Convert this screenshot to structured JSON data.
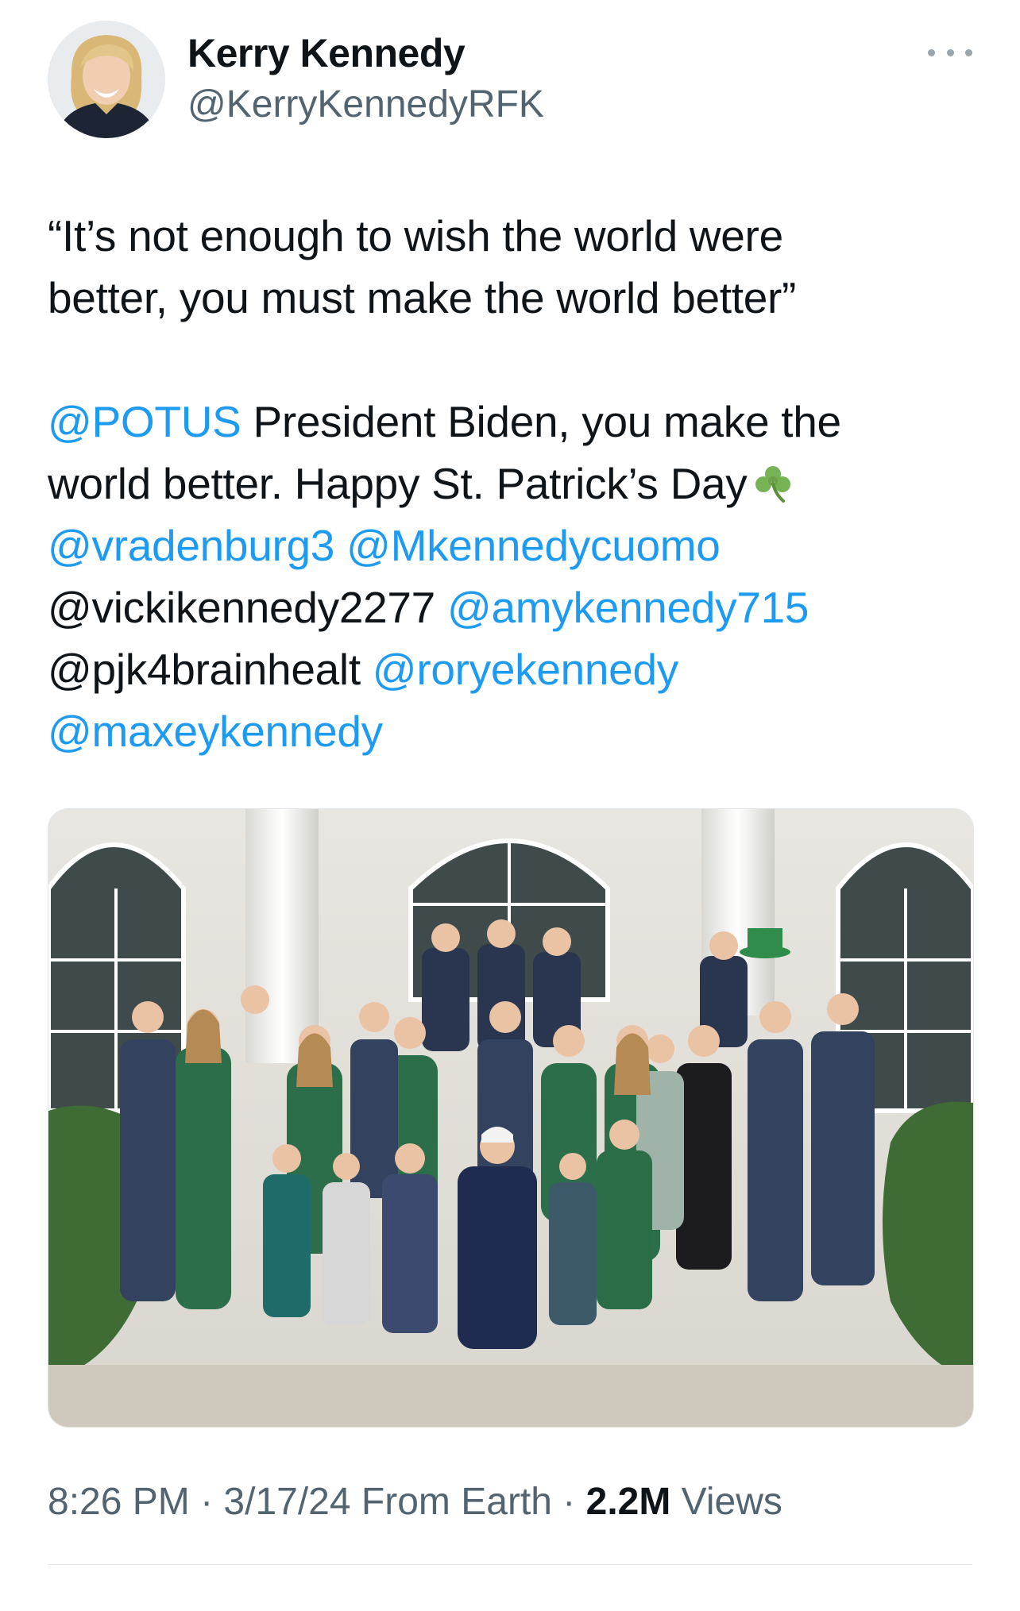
{
  "author": {
    "name": "Kerry Kennedy",
    "handle": "@KerryKennedyRFK"
  },
  "tweet": {
    "quote_line1": "“It’s not enough to wish the world were",
    "quote_line2": "better, you must make the world better”",
    "mention_potus": "@POTUS",
    "text_line3": " President Biden, you make the",
    "text_line4": "world better. Happy St. Patrick’s Day",
    "mention_vradenburg": "@vradenburg3",
    "mention_mkennedycuomo": "@Mkennedycuomo",
    "text_vickikennedy": "@vickikennedy2277",
    "mention_amykennedy": "@amykennedy715",
    "text_pjk": "@pjk4brainhealt",
    "mention_roryekennedy": "@roryekennedy",
    "mention_maxeykennedy": "@maxeykennedy",
    "emoji": "shamrock-icon"
  },
  "footer": {
    "time": "8:26 PM",
    "sep1": " · ",
    "date": "3/17/24",
    "source": " From Earth",
    "sep2": " · ",
    "views_count": "2.2M",
    "views_label": " Views"
  },
  "colors": {
    "link": "#1d9bf0",
    "text": "#0f1419",
    "secondary": "#536471"
  }
}
